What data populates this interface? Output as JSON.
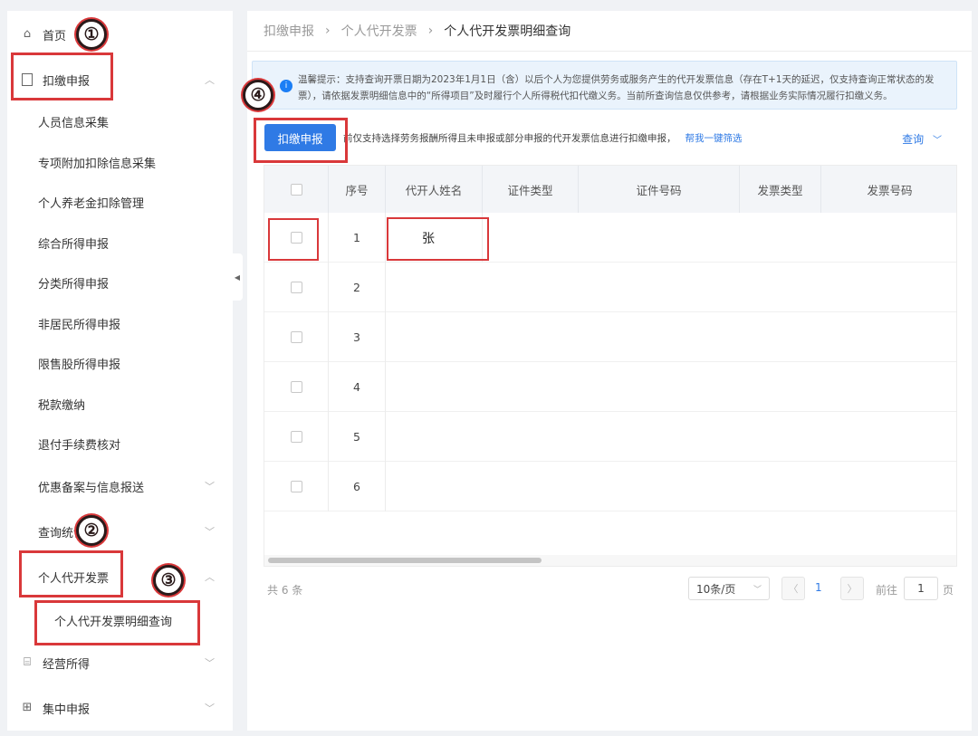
{
  "sidebar": {
    "home": "首页",
    "withholding": "扣缴申报",
    "items": [
      "人员信息采集",
      "专项附加扣除信息采集",
      "个人养老金扣除管理",
      "综合所得申报",
      "分类所得申报",
      "非居民所得申报",
      "限售股所得申报",
      "税款缴纳",
      "退付手续费核对",
      "优惠备案与信息报送",
      "查询统计",
      "个人代开发票"
    ],
    "invoice_sub": "个人代开发票明细查询",
    "business": "经营所得",
    "centralized": "集中申报"
  },
  "breadcrumb": [
    "扣缴申报",
    "个人代开发票",
    "个人代开发票明细查询"
  ],
  "notice": "温馨提示：支持查询开票日期为2023年1月1日（含）以后个人为您提供劳务或服务产生的代开发票信息（存在T+1天的延迟，仅支持查询正常状态的发票），请依据发票明细信息中的“所得项目”及时履行个人所得税代扣代缴义务。当前所查询信息仅供参考，请根据业务实际情况履行扣缴义务。",
  "actions": {
    "declare_button": "扣缴申报",
    "tip": "前仅支持选择劳务报酬所得且未申报或部分申报的代开发票信息进行扣缴申报，",
    "filter_link": "帮我一键筛选",
    "query": "查询"
  },
  "table": {
    "headers": [
      "序号",
      "代开人姓名",
      "证件类型",
      "证件号码",
      "发票类型",
      "发票号码"
    ],
    "rows": [
      {
        "seq": "1",
        "name": "张"
      },
      {
        "seq": "2",
        "name": ""
      },
      {
        "seq": "3",
        "name": ""
      },
      {
        "seq": "4",
        "name": ""
      },
      {
        "seq": "5",
        "name": ""
      },
      {
        "seq": "6",
        "name": ""
      }
    ]
  },
  "pagination": {
    "total": "共 6 条",
    "page_size": "10条/页",
    "current_page": "1",
    "goto_label": "前往",
    "goto_value": "1",
    "page_suffix": "页"
  },
  "annotations": [
    "①",
    "②",
    "③",
    "④"
  ],
  "colors": {
    "primary": "#2f7ae5",
    "annotation_red": "#d9383a",
    "notice_bg": "#eaf3fc"
  }
}
